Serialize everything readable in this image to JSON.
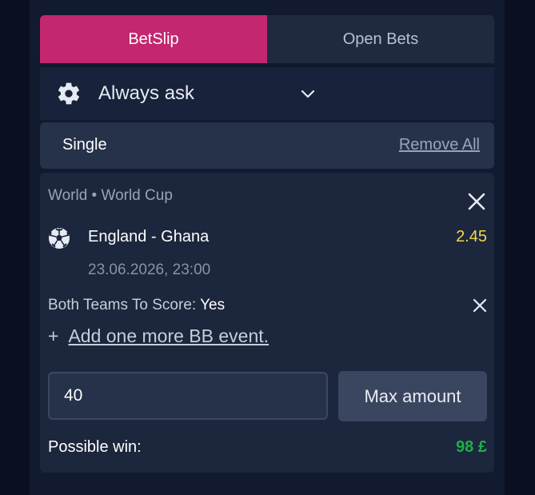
{
  "tabs": [
    {
      "label": "BetSlip",
      "active": true
    },
    {
      "label": "Open Bets",
      "active": false
    }
  ],
  "odds_setting": {
    "icon": "gear-icon",
    "label": "Always ask",
    "chevron_icon": "chevron-down-icon"
  },
  "bet_type": {
    "label": "Single",
    "remove_all_label": "Remove All"
  },
  "bet": {
    "league": "World • World Cup",
    "sport_icon": "soccer-ball-icon",
    "match": "England - Ghana",
    "odds": "2.45",
    "datetime": "23.06.2026, 23:00",
    "market_label": "Both Teams To Score:",
    "selection": "Yes",
    "add_more_plus": "+",
    "add_more_label": "Add one more BB event."
  },
  "stake": {
    "value": "40",
    "max_label": "Max amount"
  },
  "possible_win": {
    "label": "Possible win:",
    "value": "98 £"
  },
  "colors": {
    "accent": "#c2276f",
    "odds": "#f3d84a",
    "win": "#1bb04a",
    "background": "#0b1020"
  }
}
